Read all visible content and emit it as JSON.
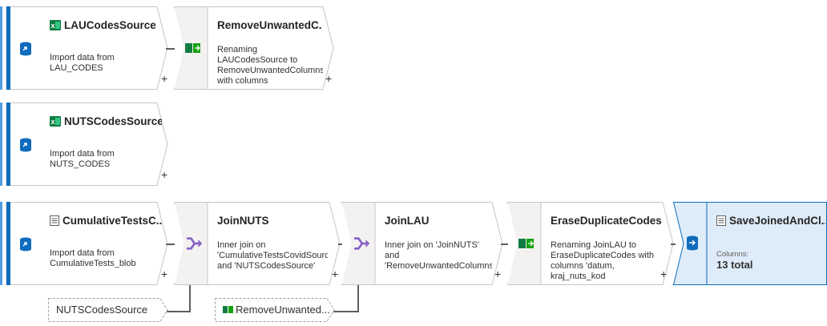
{
  "flows": [
    {
      "source": {
        "title": "LAUCodesSource",
        "description": "Import data from LAU_CODES",
        "icon": "excel-icon"
      },
      "steps": [
        {
          "title": "RemoveUnwantedC...",
          "description": "Renaming LAUCodesSource to RemoveUnwantedColumns with columns",
          "icon": "select-columns-icon"
        }
      ]
    },
    {
      "source": {
        "title": "NUTSCodesSource",
        "description": "Import data from NUTS_CODES",
        "icon": "excel-icon"
      },
      "steps": []
    },
    {
      "source": {
        "title": "CumulativeTestsC...",
        "description": "Import data from CumulativeTests_blob",
        "icon": "csv-icon"
      },
      "steps": [
        {
          "title": "JoinNUTS",
          "description": "Inner join on 'CumulativeTestsCovidSource' and 'NUTSCodesSource'",
          "icon": "join-icon"
        },
        {
          "title": "JoinLAU",
          "description": "Inner join on 'JoinNUTS' and 'RemoveUnwantedColumns'",
          "icon": "join-icon"
        },
        {
          "title": "EraseDuplicateCodes",
          "description": "Renaming JoinLAU to EraseDuplicateCodes with columns 'datum, kraj_nuts_kod",
          "icon": "select-columns-icon"
        }
      ],
      "sink": {
        "title": "SaveJoinedAndCl...",
        "columns_label": "Columns:",
        "columns_value": "13 total",
        "icon": "dataset-icon"
      }
    }
  ],
  "references": [
    {
      "label": "NUTSCodesSource"
    },
    {
      "label": "RemoveUnwanted...",
      "icon": "select-columns-icon"
    }
  ],
  "add_label": "+",
  "colors": {
    "accent": "#0f6cbd",
    "sink_fill": "#deecf9",
    "join": "#8661c5",
    "excel": "#107c41",
    "node_border": "#c8c6c4"
  }
}
